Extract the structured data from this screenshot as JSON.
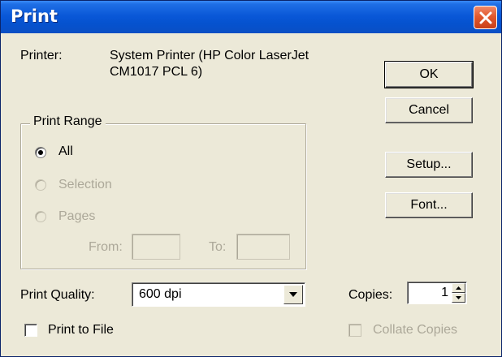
{
  "window": {
    "title": "Print"
  },
  "printer": {
    "label": "Printer:",
    "name_line1": "System Printer (HP Color LaserJet",
    "name_line2": "CM1017 PCL 6)"
  },
  "buttons": {
    "ok": "OK",
    "cancel": "Cancel",
    "setup": "Setup...",
    "font": "Font..."
  },
  "print_range": {
    "title": "Print Range",
    "options": [
      {
        "label": "All",
        "selected": true,
        "enabled": true
      },
      {
        "label": "Selection",
        "selected": false,
        "enabled": false
      },
      {
        "label": "Pages",
        "selected": false,
        "enabled": false
      }
    ],
    "from_label": "From:",
    "to_label": "To:",
    "from_value": "",
    "to_value": ""
  },
  "print_quality": {
    "label": "Print Quality:",
    "value": "600 dpi"
  },
  "copies": {
    "label": "Copies:",
    "value": "1"
  },
  "print_to_file": {
    "label": "Print to File",
    "checked": false
  },
  "collate_copies": {
    "label": "Collate Copies",
    "checked": false,
    "enabled": false
  }
}
